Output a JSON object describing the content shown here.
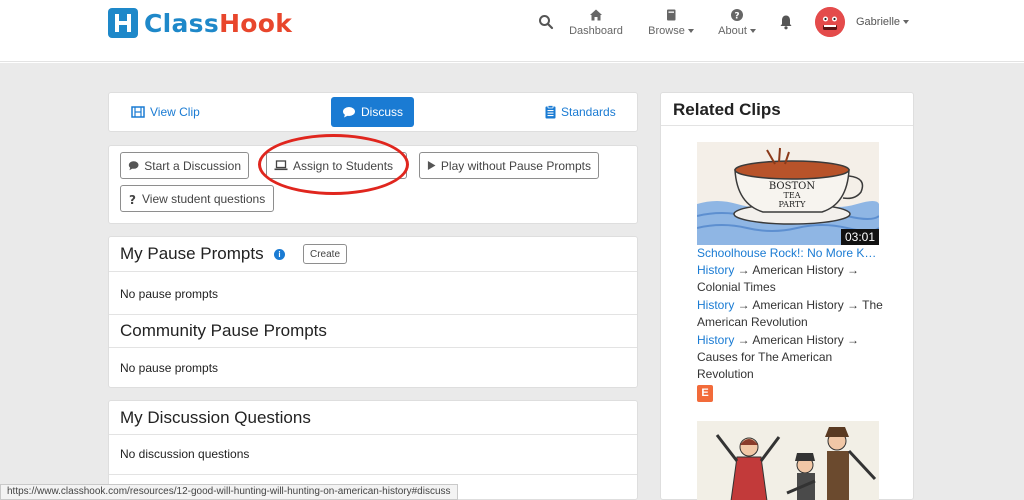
{
  "brand": {
    "name_part1": "Class",
    "name_part2": "Hook"
  },
  "nav": {
    "dashboard": "Dashboard",
    "browse": "Browse",
    "about": "About",
    "user_name": "Gabrielle"
  },
  "tabs": {
    "view_clip": "View Clip",
    "discuss": "Discuss",
    "standards": "Standards"
  },
  "actions": {
    "start_discussion": "Start a Discussion",
    "assign_students": "Assign to Students",
    "play_without": "Play without Pause Prompts",
    "view_questions": "View student questions"
  },
  "prompts": {
    "my_title": "My Pause Prompts",
    "create_label": "Create",
    "my_empty": "No pause prompts",
    "community_title": "Community Pause Prompts",
    "community_empty": "No pause prompts"
  },
  "discussion": {
    "title": "My Discussion Questions",
    "empty": "No discussion questions"
  },
  "related": {
    "title": "Related Clips",
    "clips": [
      {
        "duration": "03:01",
        "title": "Schoolhouse Rock!: No More Kings",
        "categories": [
          {
            "link": "History",
            "line1": " → American History →",
            "line2": "Colonial Times"
          },
          {
            "link": "History",
            "line1": " → American History → The",
            "line2": "American Revolution"
          },
          {
            "link": "History",
            "line1": " → American History →",
            "line2": "Causes for The American",
            "line3": "Revolution"
          }
        ],
        "rating_badge": "E",
        "thumb_text": [
          "BOSTON",
          "TEA",
          "PARTY"
        ]
      }
    ]
  },
  "status_url": "https://www.classhook.com/resources/12-good-will-hunting-will-hunting-on-american-history#discuss",
  "colors": {
    "brand_blue": "#1e88c9",
    "brand_orange": "#e8462c",
    "link_blue": "#1a7bd3",
    "annotation_red": "#e0261e",
    "badge_orange": "#f26b3a"
  }
}
